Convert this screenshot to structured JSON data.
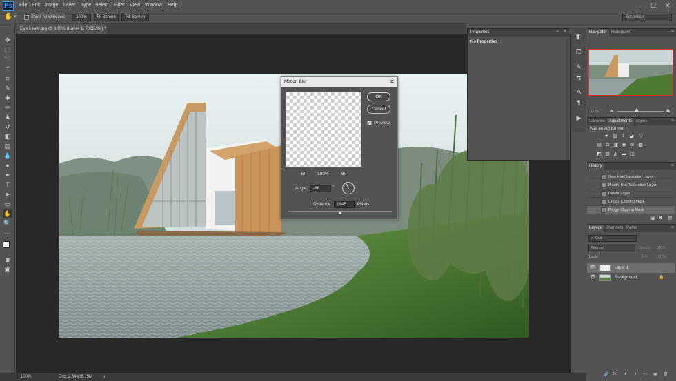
{
  "app": {
    "logo": "Ps",
    "menu": [
      "File",
      "Edit",
      "Image",
      "Layer",
      "Type",
      "Select",
      "Filter",
      "View",
      "Window",
      "Help"
    ],
    "window_controls": [
      "—",
      "☐",
      "✕"
    ]
  },
  "options_bar": {
    "scroll_all_windows": "Scroll All Windows",
    "zoom_button": "100%",
    "fit_screen": "Fit Screen",
    "fill_screen": "Fill Screen",
    "workspace": "Essentials"
  },
  "document": {
    "tab_title": "Eye Level.jpg @ 100% (Layer 1, RGB/8#) *",
    "tab_close": "×"
  },
  "status": {
    "zoom": "100%",
    "doc_size": "Doc: 2.64M/6.15M"
  },
  "properties_panel": {
    "title": "Properties",
    "content": "No Properties"
  },
  "motion_blur": {
    "title": "Motion Blur",
    "ok": "OK",
    "cancel": "Cancel",
    "preview_label": "Preview",
    "preview_checked": true,
    "zoom": "100%",
    "angle_label": "Angle:",
    "angle_value": "-66",
    "angle_unit": "°",
    "distance_label": "Distance:",
    "distance_value": "1145",
    "distance_unit": "Pixels"
  },
  "navigator": {
    "tabs": [
      "Navigator",
      "Histogram"
    ],
    "zoom": "100%"
  },
  "adjustments": {
    "tabs": [
      "Libraries",
      "Adjustments",
      "Styles"
    ],
    "heading": "Add an adjustment"
  },
  "history": {
    "title": "History",
    "items": [
      "New Hue/Saturation Layer",
      "Modify Hue/Saturation Layer",
      "Delete Layer",
      "Create Clipping Mask",
      "Merge Clipping Mask"
    ]
  },
  "layers": {
    "tabs": [
      "Layers",
      "Channels",
      "Paths"
    ],
    "filter": "Kind",
    "blend_mode": "Normal",
    "opacity_label": "Opacity:",
    "opacity_value": "100%",
    "lock_label": "Lock:",
    "fill_label": "Fill:",
    "fill_value": "100%",
    "items": [
      {
        "name": "Layer 1",
        "selected": true
      },
      {
        "name": "Background",
        "selected": false
      }
    ],
    "footer_icons": [
      "🔗",
      "fx",
      "◐",
      "◑",
      "▭",
      "▣",
      "🗑"
    ]
  },
  "colors": {
    "accent": "#31a8ff",
    "panel_bg": "#535353",
    "canvas_bg": "#282828",
    "nav_frame": "#e03030"
  }
}
